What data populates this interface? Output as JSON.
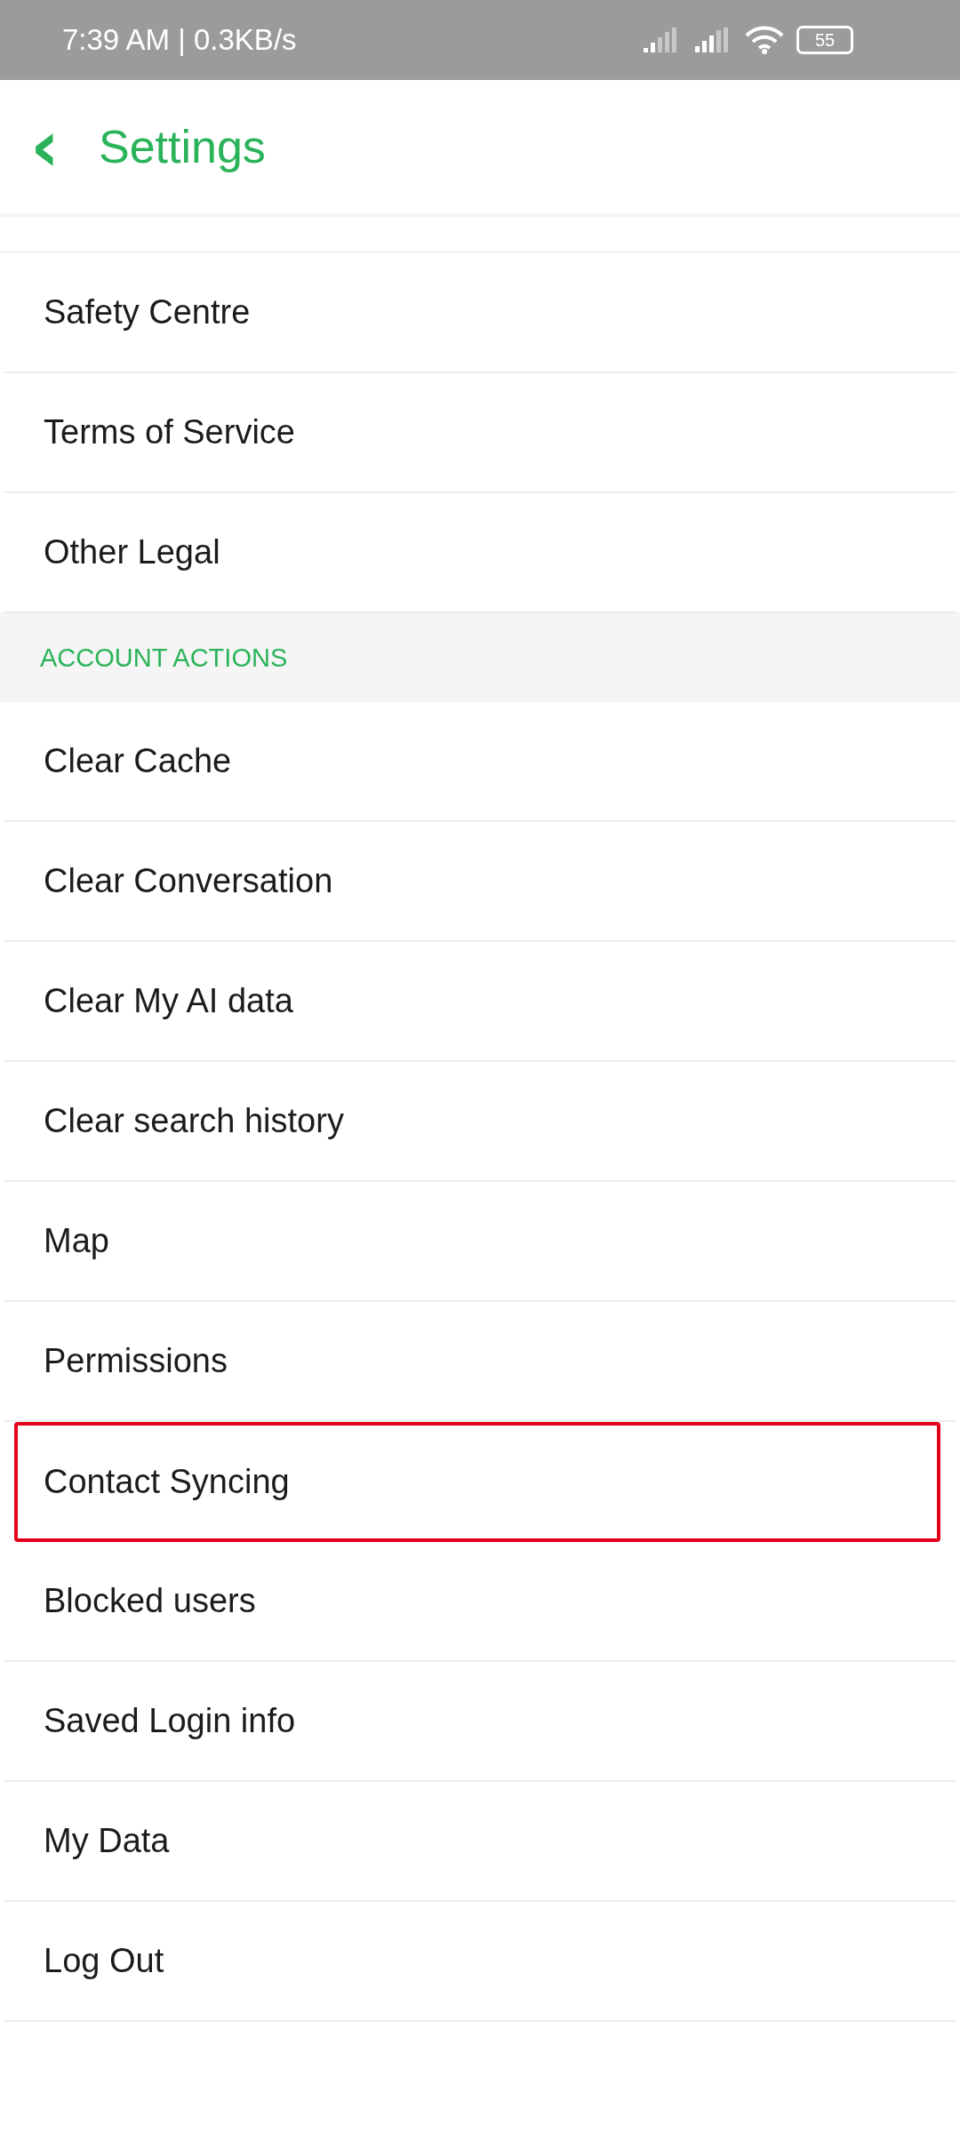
{
  "status_bar": {
    "time": "7:39 AM | 0.3KB/s",
    "battery": "55"
  },
  "header": {
    "back": "‹",
    "title": "Settings"
  },
  "sections": [
    {
      "items": [
        {
          "label": "Safety Centre",
          "highlighted": false
        },
        {
          "label": "Terms of Service",
          "highlighted": false
        },
        {
          "label": "Other Legal",
          "highlighted": false
        }
      ]
    },
    {
      "title": "ACCOUNT ACTIONS",
      "items": [
        {
          "label": "Clear Cache",
          "highlighted": false
        },
        {
          "label": "Clear Conversation",
          "highlighted": false
        },
        {
          "label": "Clear My AI data",
          "highlighted": false
        },
        {
          "label": "Clear search history",
          "highlighted": false
        },
        {
          "label": "Map",
          "highlighted": false
        },
        {
          "label": "Permissions",
          "highlighted": false
        },
        {
          "label": "Contact Syncing",
          "highlighted": true
        },
        {
          "label": "Blocked users",
          "highlighted": false
        },
        {
          "label": "Saved Login info",
          "highlighted": false
        },
        {
          "label": "My Data",
          "highlighted": false
        },
        {
          "label": "Log Out",
          "highlighted": false
        }
      ]
    }
  ]
}
